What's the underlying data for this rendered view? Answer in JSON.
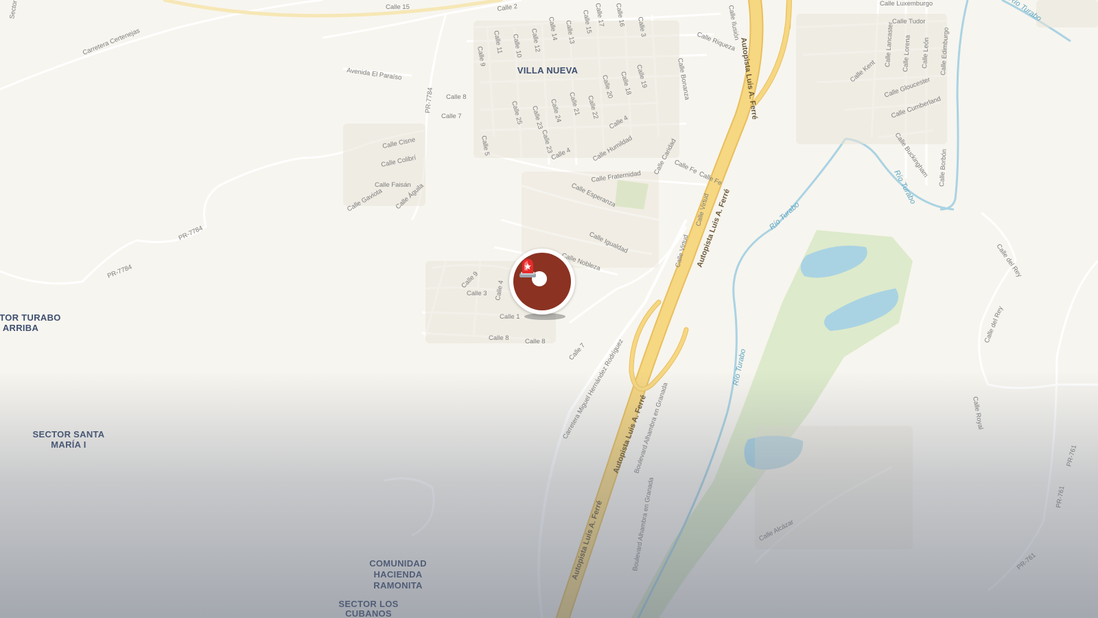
{
  "colors": {
    "land": "#f7f5ef",
    "motorway": "#f6d782",
    "motorway_casing": "#e8bf5d",
    "minor_road": "#ffffff",
    "building": "#e9e4d8",
    "water": "#a9d3e3",
    "park": "#d9e9c6",
    "marker_core": "#8b3222",
    "label_place": "#3e4f70"
  },
  "places": {
    "villa_nueva": "VILLA NUEVA",
    "turabo_arriba_1": "TOR TURABO",
    "turabo_arriba_2": "ARRIBA",
    "santa_maria_1": "SECTOR SANTA",
    "santa_maria_2": "MARÍA I",
    "ramonita_1": "COMUNIDAD",
    "ramonita_2": "HACIENDA",
    "ramonita_3": "RAMONITA",
    "cubanos_1": "SECTOR LOS",
    "cubanos_2": "CUBANOS"
  },
  "highways": {
    "autopista": "Autopista Luis A. Ferré",
    "pr7784": "PR-7784",
    "pr761": "PR-761",
    "carretera_certenejas": "Carretera Certenejas",
    "carretera_mhr": "Carretera Miguel Hernández Rodríguez"
  },
  "rivers": {
    "rio_turabo": "Río Turabo"
  },
  "streets": {
    "calle15": "Calle 15",
    "calle2": "Calle 2",
    "calle17": "Calle 17",
    "calle16": "Calle 16",
    "calle3": "Calle 3",
    "calle11": "Calle 11",
    "calle10": "Calle 10",
    "calle12": "Calle 12",
    "calle14": "Calle 14",
    "calle13": "Calle 13",
    "calle9": "Calle 9",
    "calle8": "Calle 8",
    "calle7": "Calle 7",
    "calle5": "Calle 5",
    "calle25": "Calle 25",
    "calle23": "Calle 23",
    "calle24": "Calle 24",
    "calle21": "Calle 21",
    "calle22": "Calle 22",
    "calle20": "Calle 20",
    "calle18": "Calle 18",
    "calle19": "Calle 19",
    "calle4": "Calle 4",
    "calle1": "Calle 1",
    "avenida_paraiso": "Avenida El Paraíso",
    "ilusion": "Calle Ilusión",
    "riqueza": "Calle Riqueza",
    "bonanza": "Calle Bonanza",
    "cisne": "Calle Cisne",
    "colibri": "Calle Colibrí",
    "faisan": "Calle Faisán",
    "gaviota": "Calle Gaviota",
    "aguila": "Calle Águila",
    "humildad": "Calle Humildad",
    "caridad": "Calle Caridad",
    "fe": "Calle Fe",
    "fraternidad": "Calle Fraternidad",
    "esperanza": "Calle Esperanza",
    "virtud": "Calle Virtud",
    "igualdad": "Calle Igualdad",
    "nobleza": "Calle Nobleza",
    "luxemburgo": "Calle Luxemburgo",
    "tudor": "Calle Tudor",
    "lancaster": "Calle Lancaster",
    "lorena": "Calle Lorena",
    "leon": "Calle León",
    "edimburgo": "Calle Edimburgo",
    "kent": "Calle Kent",
    "gloucester": "Calle Gloucester",
    "cumberland": "Calle Cumberland",
    "buckingham": "Calle Buckingham",
    "borbon": "Calle Borbón",
    "del_rey": "Calle del Rey",
    "royal": "Calle Royal",
    "alcazar": "Calle Alcázar",
    "alhambra": "Boulevard Alhambra en Granada",
    "sector": "Sector"
  },
  "marker": {
    "icon": "siren-icon",
    "color": "#8b3222"
  }
}
